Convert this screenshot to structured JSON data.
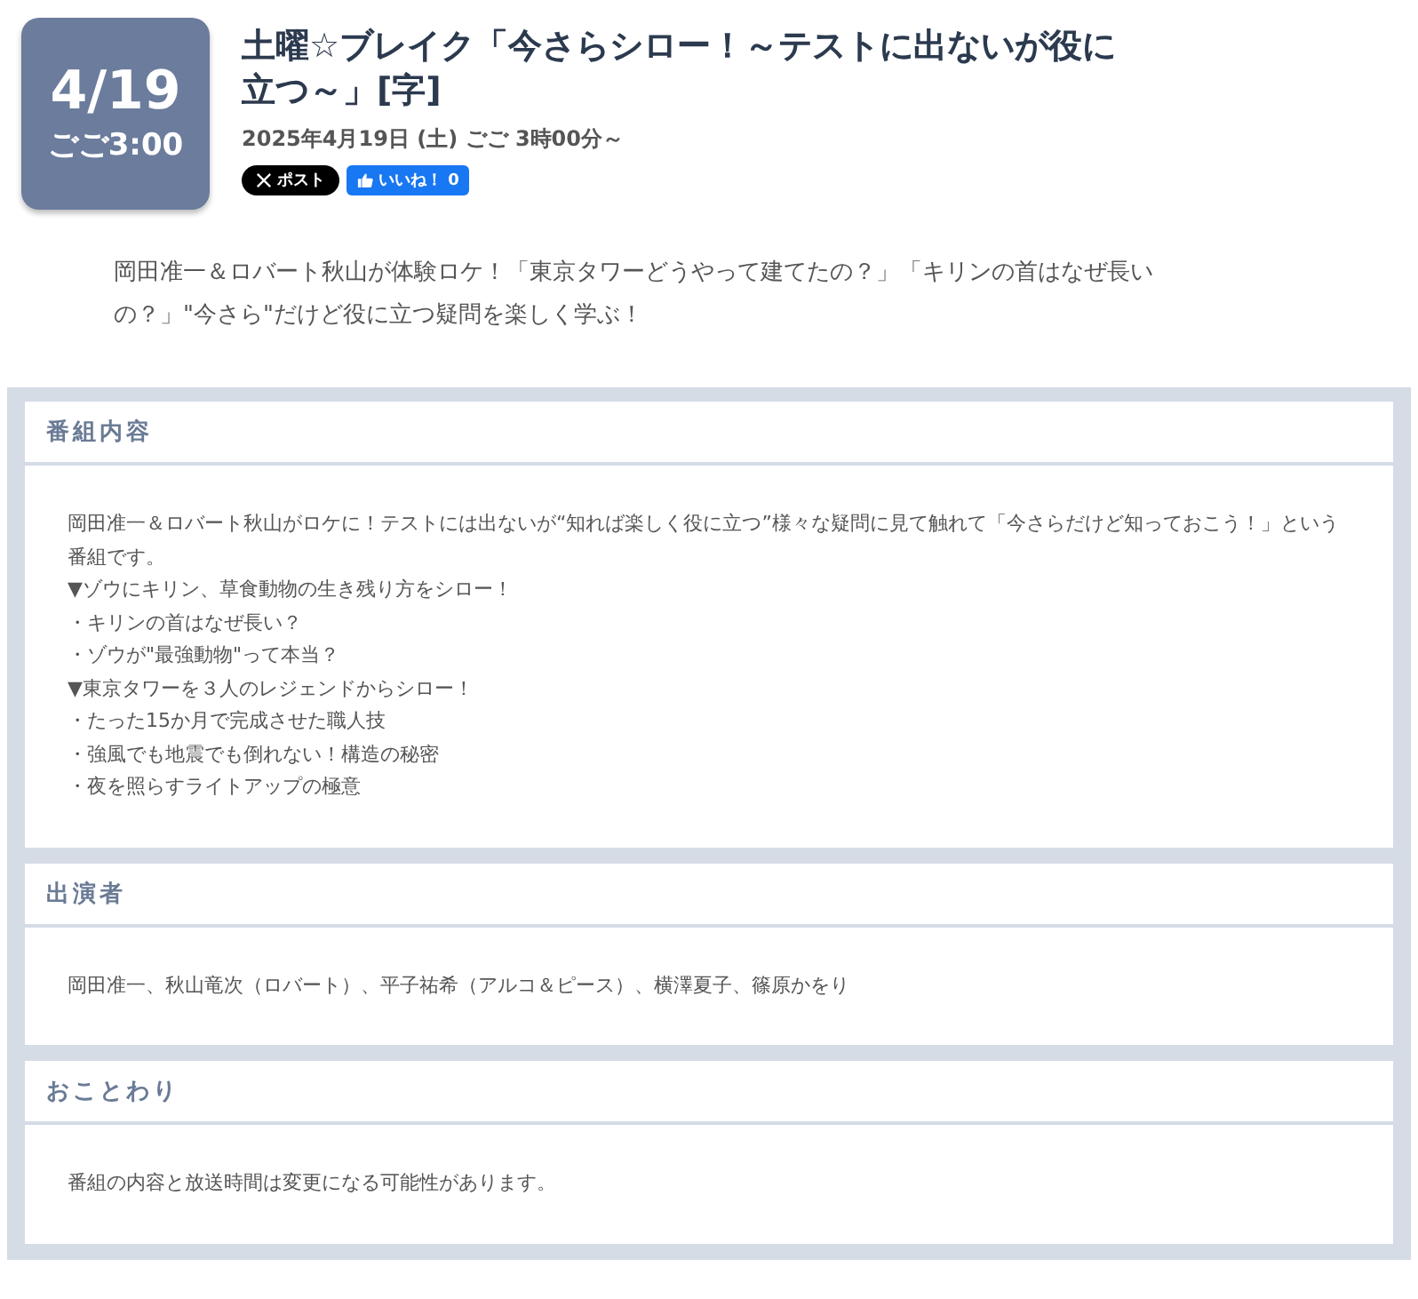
{
  "badge": {
    "date": "4/19",
    "time": "ごご3:00"
  },
  "title": "土曜☆ブレイク「今さらシロー！～テストに出ないが役に立つ～」[字]",
  "air_date": "2025年4月19日 (土) ごご 3時00分～",
  "share_buttons": [
    {
      "kind": "x",
      "label": "ポスト"
    },
    {
      "kind": "like",
      "label": "いいね！",
      "count": "0"
    }
  ],
  "lead": "岡田准一＆ロバート秋山が体験ロケ！「東京タワーどうやって建てたの？」「キリンの首はなぜ長いの？」\"今さら\"だけど役に立つ疑問を楽しく学ぶ！",
  "sections": [
    {
      "heading": "番組内容",
      "lines": [
        "岡田准一＆ロバート秋山がロケに！テストには出ないが“知れば楽しく役に立つ”様々な疑問に見て触れて「今さらだけど知っておこう！」という番組です。",
        "▼ゾウにキリン、草食動物の生き残り方をシロー！",
        "・キリンの首はなぜ長い？",
        "・ゾウが\"最強動物\"って本当？",
        "▼東京タワーを３人のレジェンドからシロー！",
        "・たった15か月で完成させた職人技",
        "・強風でも地震でも倒れない！構造の秘密",
        "・夜を照らすライトアップの極意"
      ]
    },
    {
      "heading": "出演者",
      "lines": [
        "岡田准一、秋山竜次（ロバート）、平子祐希（アルコ＆ピース）、横澤夏子、篠原かをり"
      ]
    },
    {
      "heading": "おことわり",
      "lines": [
        "番組の内容と放送時間は変更になる可能性があります。"
      ]
    }
  ]
}
